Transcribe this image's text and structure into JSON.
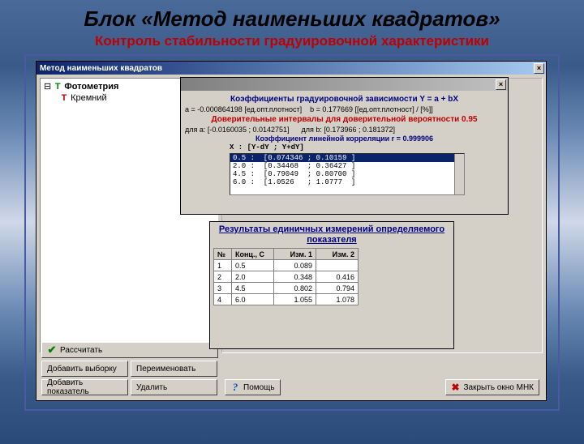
{
  "slide": {
    "title": "Блок «Метод наименьших квадратов»",
    "subtitle": "Контроль стабильности градуировочной характеристики"
  },
  "mainWindow": {
    "title": "Метод наименьших квадратов",
    "closeGlyph": "×"
  },
  "tree": {
    "item1": "Фотометрия",
    "item2": "Кремний"
  },
  "buttons": {
    "calc": "Рассчитать",
    "addSample": "Добавить выборку",
    "addIndicator": "Добавить показатель",
    "rename": "Переименовать",
    "delete": "Удалить",
    "help": "Помощь",
    "closeMain": "Закрыть окно МНК"
  },
  "info": {
    "title1": "Коэффициенты градуировочной зависимости  Y = a + bX",
    "a_prefix": "a = ",
    "a_val": "-0.000864198 [ед.опт.плотност]",
    "b_prefix": "b = ",
    "b_val": "0.177669 [[ед.опт.плотност] / [%]]",
    "title2": "Доверительные интервалы для доверительной вероятности 0.95",
    "ci_a_lbl": "для a:",
    "ci_a_val": "[-0.0160035 ; 0.0142751]",
    "ci_b_lbl": "для b:",
    "ci_b_val": "[0.173966 ; 0.181372]",
    "corr_lbl": "Коэффициент линейной корреляции   r = ",
    "corr_val": "0.999906",
    "list_hdr": "X  :  [Y-dY  ;  Y+dY]"
  },
  "intervals": [
    {
      "txt": "0.5 :  [0.074346 ; 0.10159 ]"
    },
    {
      "txt": "2.0 :  [0.34468  ; 0.36427 ]"
    },
    {
      "txt": "4.5 :  [0.79049  ; 0.80700 ]"
    },
    {
      "txt": "6.0 :  [1.0526   ; 1.0777  ]"
    }
  ],
  "results": {
    "title": "Результаты единичных измерений определяемого показателя",
    "col_no": "№",
    "col_conc": "Конц., C",
    "col_m1": "Изм. 1",
    "col_m2": "Изм. 2",
    "rows": [
      {
        "n": "1",
        "c": "0.5",
        "m1": "0.089",
        "m2": ""
      },
      {
        "n": "2",
        "c": "2.0",
        "m1": "0.348",
        "m2": "0.416"
      },
      {
        "n": "3",
        "c": "4.5",
        "m1": "0.802",
        "m2": "0.794"
      },
      {
        "n": "4",
        "c": "6.0",
        "m1": "1.055",
        "m2": "1.078"
      }
    ]
  }
}
